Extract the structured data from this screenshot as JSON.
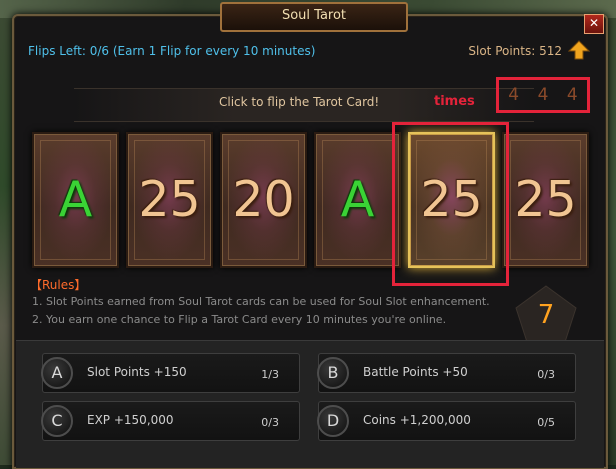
{
  "window": {
    "title": "Soul Tarot",
    "close_icon": "✕"
  },
  "header": {
    "flips_left": "Flips Left: 0/6 (Earn 1 Flip for every 10 minutes)",
    "slot_points": "Slot Points: 512"
  },
  "prompt": {
    "click_text": "Click to flip the Tarot Card!",
    "times_label": "times",
    "times_digits": [
      "4",
      "4",
      "4"
    ]
  },
  "cards": [
    {
      "value": "A",
      "kind": "letter"
    },
    {
      "value": "25",
      "kind": "number"
    },
    {
      "value": "20",
      "kind": "number"
    },
    {
      "value": "A",
      "kind": "letter"
    },
    {
      "value": "25",
      "kind": "number",
      "selected": true
    },
    {
      "value": "25",
      "kind": "number"
    }
  ],
  "rules": {
    "title": "【Rules】",
    "items": [
      "1. Slot Points earned from Soul Tarot cards can be used for Soul Slot enhancement.",
      "2. You earn one chance to Flip a Tarot Card every 10 minutes you're online."
    ],
    "pentagon_value": "7"
  },
  "rewards": [
    {
      "badge": "A",
      "label": "Slot Points +150",
      "count": "1/3"
    },
    {
      "badge": "B",
      "label": "Battle Points +50",
      "count": "0/3"
    },
    {
      "badge": "C",
      "label": "EXP +150,000",
      "count": "0/3"
    },
    {
      "badge": "D",
      "label": "Coins +1,200,000",
      "count": "0/5"
    }
  ],
  "colors": {
    "flips_text": "#4fc0ea",
    "highlight": "#e4233a",
    "letter_card": "#3ad335",
    "number_card": "#f1c592",
    "pentagon_number": "#ffa21f"
  }
}
